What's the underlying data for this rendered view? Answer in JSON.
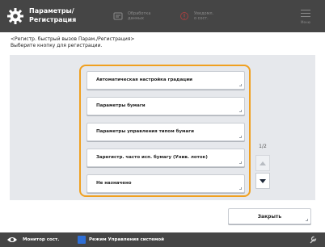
{
  "header": {
    "title": "Параметры/\nРегистрация",
    "status1": "Обработка\nданных",
    "status2": "Уведомл.\nо сост.",
    "menu_label": "Меню"
  },
  "instruction": "<Регистр. быстрый вызов Парам./Регистрация>\nВыберите кнопку для регистрации.",
  "items": [
    {
      "label": "Автоматическая настройка градации"
    },
    {
      "label": "Параметры бумаги"
    },
    {
      "label": "Параметры управления типом бумаги"
    },
    {
      "label": "Зарегистр. часто исп. бумагу (Унив. лоток)"
    },
    {
      "label": "Не назначено"
    }
  ],
  "pager": {
    "indicator": "1/2"
  },
  "close_label": "Закрыть",
  "footer": {
    "monitor_label": "Монитор сост.",
    "mode_label": "Режим Управления системой"
  },
  "colors": {
    "header_bg": "#454545",
    "panel_bg": "#e6e8ec",
    "highlight": "#f0a020",
    "mode_icon": "#2f6fd6"
  },
  "icons": {
    "header": "gear-icon",
    "status1": "data-processing-icon",
    "status2": "status-notification-icon",
    "menu": "menu-icon",
    "monitor": "eye-icon",
    "mode": "system-mode-icon",
    "footer_right": "wrench-icon"
  }
}
